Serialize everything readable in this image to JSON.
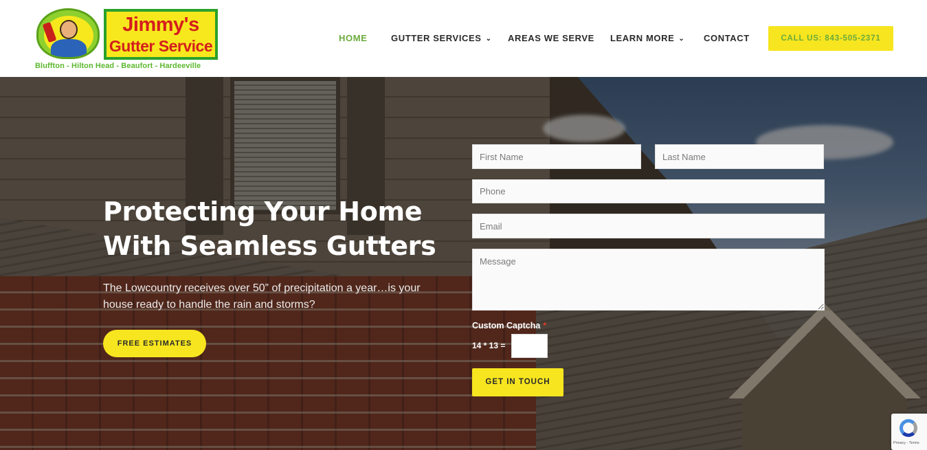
{
  "header": {
    "logo": {
      "title_line1": "Jimmy's",
      "title_line2": "Gutter Service",
      "tagline": "Bluffton - Hilton Head - Beaufort - Hardeeville"
    },
    "nav": {
      "home": "HOME",
      "gutter_services": "GUTTER SERVICES",
      "areas": "AREAS WE SERVE",
      "learn_more": "LEARN MORE",
      "contact": "CONTACT"
    },
    "call_button": "CALL US: 843-505-2371"
  },
  "hero": {
    "title": "Protecting Your Home With Seamless Gutters",
    "text": "The Lowcountry receives over 50” of precipitation a year…is your house ready to handle the rain and storms?",
    "cta": "FREE ESTIMATES"
  },
  "form": {
    "first_name_placeholder": "First Name",
    "last_name_placeholder": "Last Name",
    "phone_placeholder": "Phone",
    "email_placeholder": "Email",
    "message_placeholder": "Message",
    "captcha_label": "Custom Captcha",
    "captcha_required": "*",
    "captcha_question": "14 * 13 =",
    "captcha_value": "",
    "submit": "GET IN TOUCH"
  },
  "recaptcha": {
    "text": "Privacy - Terms"
  },
  "colors": {
    "accent_yellow": "#f7e51f",
    "accent_green": "#6aab3b",
    "logo_red": "#d41e1e"
  },
  "icons": {
    "dropdown": "chevron-down-icon",
    "recaptcha": "recaptcha-icon"
  }
}
